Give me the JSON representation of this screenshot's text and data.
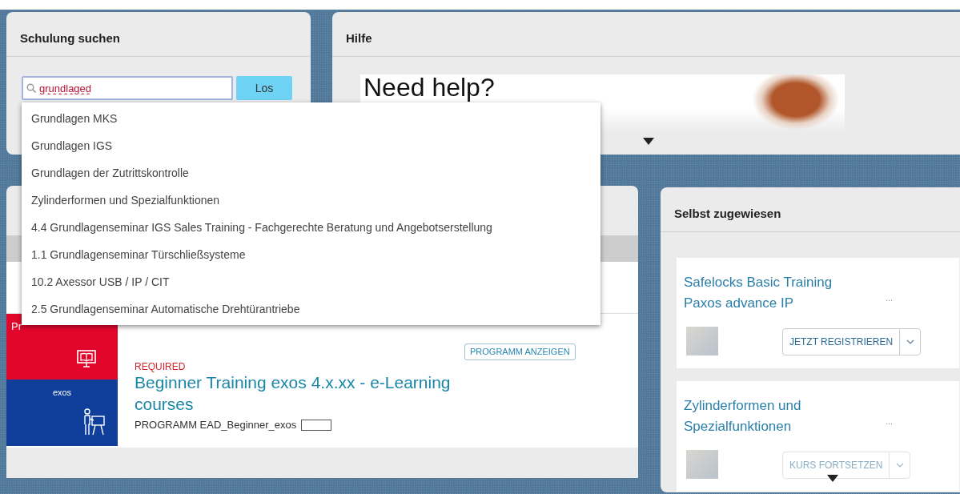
{
  "search": {
    "title": "Schulung suchen",
    "query": "grundlaged",
    "button": "Los"
  },
  "suggestions": [
    {
      "label": "Grundlagen MKS"
    },
    {
      "label": "Grundlagen IGS"
    },
    {
      "label": "Grundlagen der Zutrittskontrolle"
    },
    {
      "label": "Zylinderformen und Spezialfunktionen"
    },
    {
      "label": "4.4 Grundlagenseminar IGS Sales Training - Fachgerechte Beratung und Angebotserstellung"
    },
    {
      "label": "1.1 Grundlagenseminar Türschließsysteme"
    },
    {
      "label": "10.2 Axessor USB / IP / CIT"
    },
    {
      "label": "2.5 Grundlagenseminar Automatische Drehtürantriebe"
    }
  ],
  "help": {
    "title": "Hilfe",
    "banner_heading": "Need help?"
  },
  "program": {
    "tile_label": "Pr",
    "tile_caption": "exos",
    "button": "PROGRAMM ANZEIGEN",
    "status": "REQUIRED",
    "title": "Beginner Training exos 4.x.xx - e-Learning courses",
    "subtitle": "PROGRAMM EAD_Beginner_exos"
  },
  "self_assigned": {
    "title": "Selbst zugewiesen",
    "items": [
      {
        "title": "Safelocks Basic Training Paxos advance IP",
        "more": "...",
        "action": "JETZT REGISTRIEREN"
      },
      {
        "title": "Zylinderformen und Spezialfunktionen",
        "more": "...",
        "action": "KURS FORTSETZEN"
      }
    ]
  }
}
